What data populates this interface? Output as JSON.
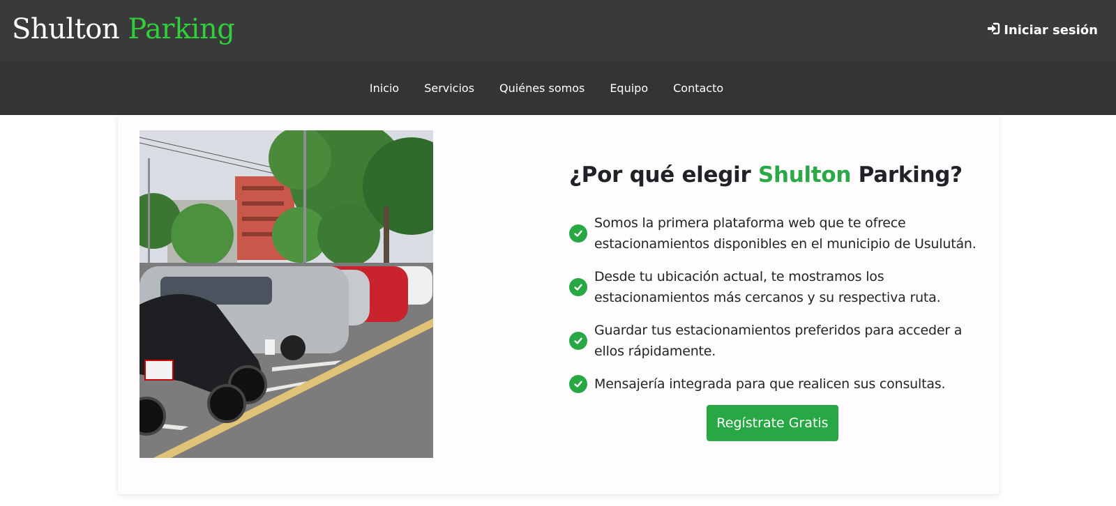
{
  "header": {
    "brand_main": "Shulton",
    "brand_accent": "Parking",
    "login_label": "Iniciar sesión",
    "login_icon": "sign-in-icon"
  },
  "nav": {
    "items": [
      {
        "label": "Inicio"
      },
      {
        "label": "Servicios"
      },
      {
        "label": "Quiénes somos"
      },
      {
        "label": "Equipo"
      },
      {
        "label": "Contacto"
      }
    ]
  },
  "main": {
    "headline_prefix": "¿Por qué elegir ",
    "headline_accent": "Shulton",
    "headline_suffix": " Parking?",
    "features": [
      {
        "text": "Somos la primera plataforma web que te ofrece estacionamientos disponibles en el municipio de Usulután."
      },
      {
        "text": "Desde tu ubicación actual, te mostramos los estacionamientos más cercanos y su respectiva ruta."
      },
      {
        "text": "Guardar tus estacionamientos preferidos para acceder a ellos rápidamente."
      },
      {
        "text": "Mensajería integrada para que realicen sus consultas."
      }
    ],
    "cta_label": "Regístrate Gratis"
  },
  "colors": {
    "brand_accent": "#2fce3a",
    "primary_green": "#28a745",
    "topbar": "#3a3a3a",
    "navbar": "#343434"
  }
}
